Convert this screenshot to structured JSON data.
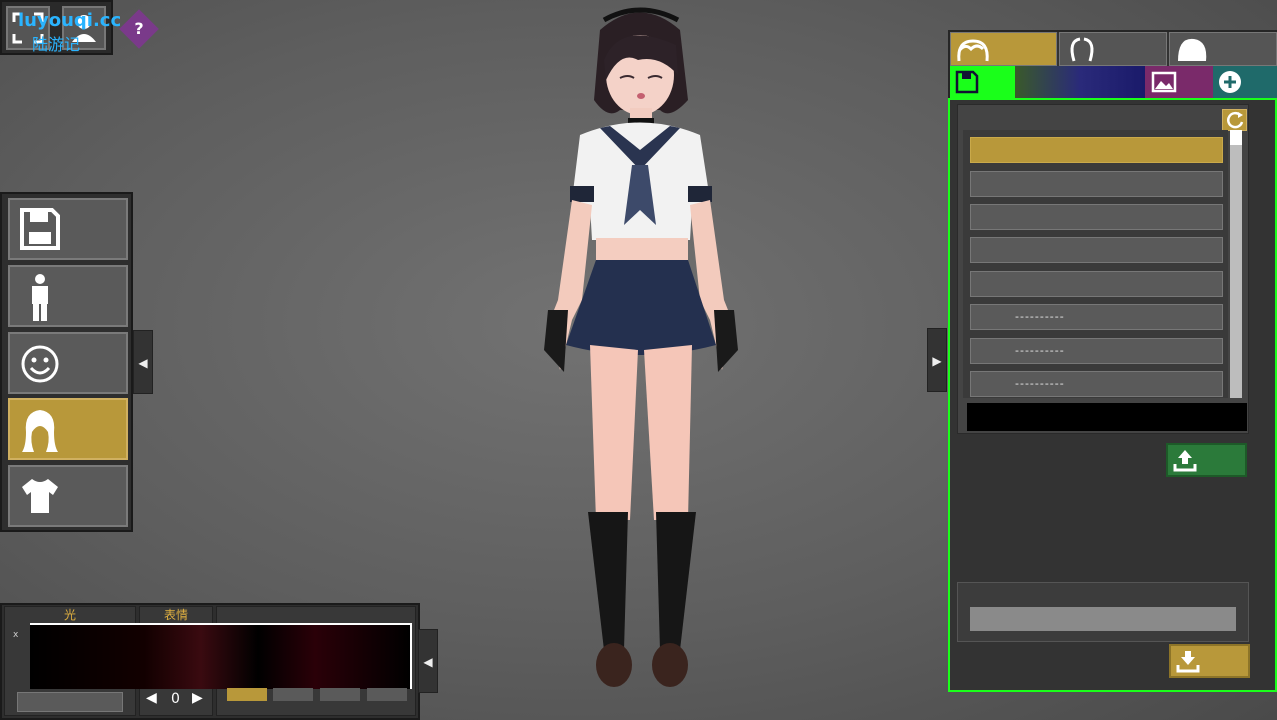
{
  "watermark": {
    "line1": "luyouqi.cc",
    "line2": "陆游记"
  },
  "help": {
    "label": "?"
  },
  "bottom_panel": {
    "col1_header": "光",
    "col2_header": "表情",
    "stepper_value": "0",
    "x_label": "x"
  },
  "right_panel": {
    "list_items": [
      {
        "text": "",
        "selected": true
      },
      {
        "text": "",
        "selected": false
      },
      {
        "text": "",
        "selected": false
      },
      {
        "text": "",
        "selected": false
      },
      {
        "text": "",
        "selected": false
      },
      {
        "text": "----------",
        "selected": false
      },
      {
        "text": "----------",
        "selected": false
      },
      {
        "text": "----------",
        "selected": false
      }
    ]
  },
  "colors": {
    "accent_gold": "#b8983a",
    "save_green": "#1aff1a",
    "upload_green": "#2b7a3a",
    "panel_dark": "#333333",
    "help_purple": "#7a3a8a",
    "watermark_blue": "#2ab4ff"
  },
  "icons": {
    "left_menu": [
      "save-icon",
      "body-icon",
      "face-icon",
      "hair-icon",
      "clothing-icon"
    ],
    "right_tabs": [
      "hair-front-icon",
      "hair-side-icon",
      "hair-back-icon"
    ],
    "sub_toolbar": [
      "save-icon",
      "image-icon",
      "add-icon"
    ]
  }
}
